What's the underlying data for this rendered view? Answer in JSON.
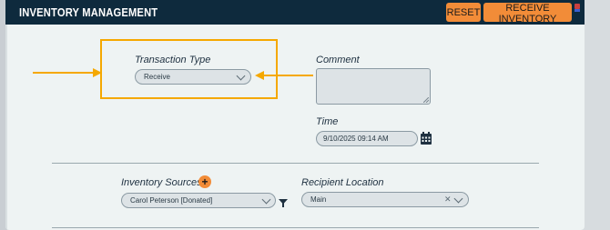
{
  "header": {
    "title": "INVENTORY MANAGEMENT",
    "reset_label": "RESET",
    "receive_label": "RECEIVE INVENTORY"
  },
  "form": {
    "transaction_type": {
      "label": "Transaction Type",
      "value": "Receive"
    },
    "comment": {
      "label": "Comment",
      "value": ""
    },
    "time": {
      "label": "Time",
      "value": "9/10/2025 09:14 AM"
    },
    "inventory_sources": {
      "label": "Inventory Sources",
      "required_marker": "*",
      "value": "Carol Peterson [Donated]"
    },
    "recipient_location": {
      "label": "Recipient Location",
      "value": "Main"
    }
  },
  "colors": {
    "header_bg": "#0e2a3d",
    "accent": "#f28c38",
    "highlight": "#f5a800",
    "panel_bg": "#eef3f3"
  },
  "icons": [
    "chevron-down-icon",
    "calendar-icon",
    "plus-icon",
    "filter-icon",
    "clear-icon",
    "arrow-right-icon",
    "arrow-left-icon"
  ]
}
